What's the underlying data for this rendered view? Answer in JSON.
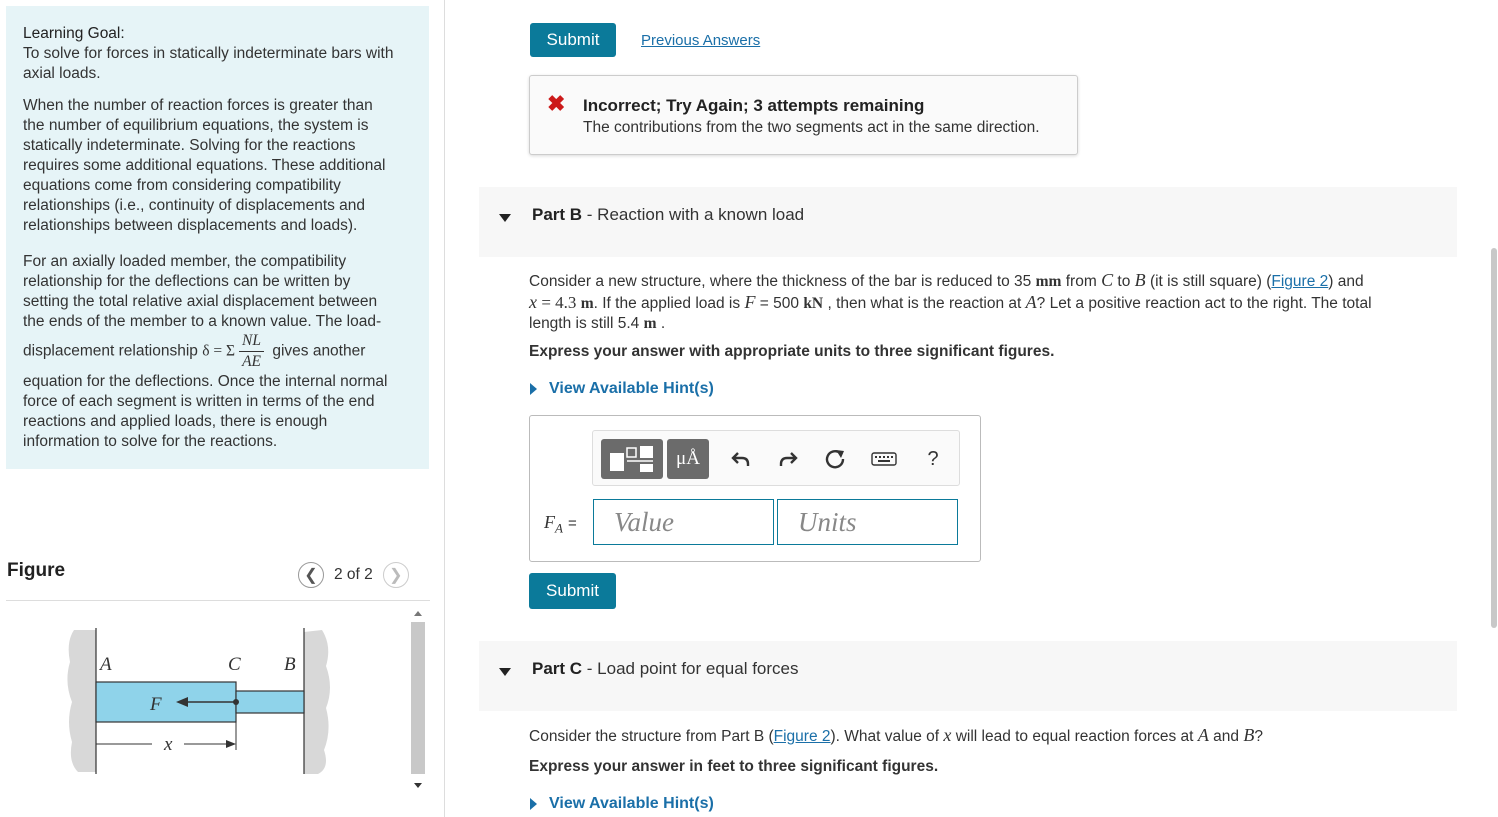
{
  "learning_goal": {
    "heading": "Learning Goal:",
    "lines": [
      "To solve for forces in statically indeterminate bars with",
      "axial loads."
    ],
    "para1": [
      "When the number of reaction forces is greater than",
      "the number of equilibrium equations, the system is",
      "statically indeterminate. Solving for the reactions",
      "requires some additional equations. These additional",
      "equations come from considering compatibility",
      "relationships (i.e., continuity of displacements and",
      "relationships between displacements and loads)."
    ],
    "para2": [
      "For an axially loaded member, the compatibility",
      "relationship for the deflections can be written by",
      "setting the total relative axial displacement between",
      "the ends of the member to a known value. The load-"
    ],
    "formula_prefix": "displacement relationship",
    "formula_lhs": "δ = Σ",
    "formula_num": "NL",
    "formula_den": "AE",
    "formula_suffix": "gives another",
    "para3": [
      "equation for the deflections. Once the internal normal",
      "force of each segment is written in terms of the end",
      "reactions and applied loads, there is enough",
      "information to solve for the reactions."
    ]
  },
  "figure": {
    "title": "Figure",
    "pager": "2 of 2",
    "labels": {
      "a": "A",
      "c": "C",
      "b": "B",
      "f": "F",
      "x": "x"
    },
    "colors": {
      "bar": "#8fd3ea",
      "wall": "#d8d8d8"
    }
  },
  "part_a": {
    "submit_label": "Submit",
    "previous_answers": "Previous Answers",
    "feedback_title": "Incorrect; Try Again; 3 attempts remaining",
    "feedback_msg": "The contributions from the two segments act in the same direction."
  },
  "part_b": {
    "part_label": "Part B",
    "title": " - Reaction with a known load",
    "q_1": "Consider a new structure, where the thickness of the bar is reduced to 35",
    "q_unit_mm": "mm",
    "q_2": "from",
    "q_c": "C",
    "q_3": "to",
    "q_b": "B",
    "q_4": "(it is still square) (",
    "q_fig": "Figure 2",
    "q_5": ") and",
    "q_x": "x",
    "q_6": "= 4.3",
    "q_unit_m": "m",
    "q_7": ". If the applied load is",
    "q_f": "F",
    "q_8": "= 500",
    "q_unit_kn": "kN",
    "q_9": ", then what is the reaction at",
    "q_a": "A",
    "q_10": "? Let a positive reaction act to the right. The total",
    "q_11": "length is still 5.4",
    "q_unit_m2": "m",
    "q_12": ".",
    "instruction": "Express your answer with appropriate units to three significant figures.",
    "hint": "View Available Hint(s)",
    "answer_label": "F",
    "answer_sub": "A",
    "answer_eq": "=",
    "value_placeholder": "Value",
    "units_placeholder": "Units",
    "mu_a": "μÅ",
    "help": "?",
    "submit_label": "Submit"
  },
  "part_c": {
    "part_label": "Part C",
    "title": " - Load point for equal forces",
    "q_1": "Consider the structure from Part B (",
    "q_fig": "Figure 2",
    "q_2": "). What value of",
    "q_x": "x",
    "q_3": "will lead to equal reaction forces at",
    "q_a": "A",
    "q_4": "and",
    "q_b": "B",
    "q_5": "?",
    "instruction": "Express your answer in feet to three significant figures.",
    "hint": "View Available Hint(s)"
  },
  "colors": {
    "accent": "#0b7a9a",
    "link": "#1a6fa8",
    "error": "#cc1a1a",
    "goal_bg": "#e6f4f7"
  }
}
